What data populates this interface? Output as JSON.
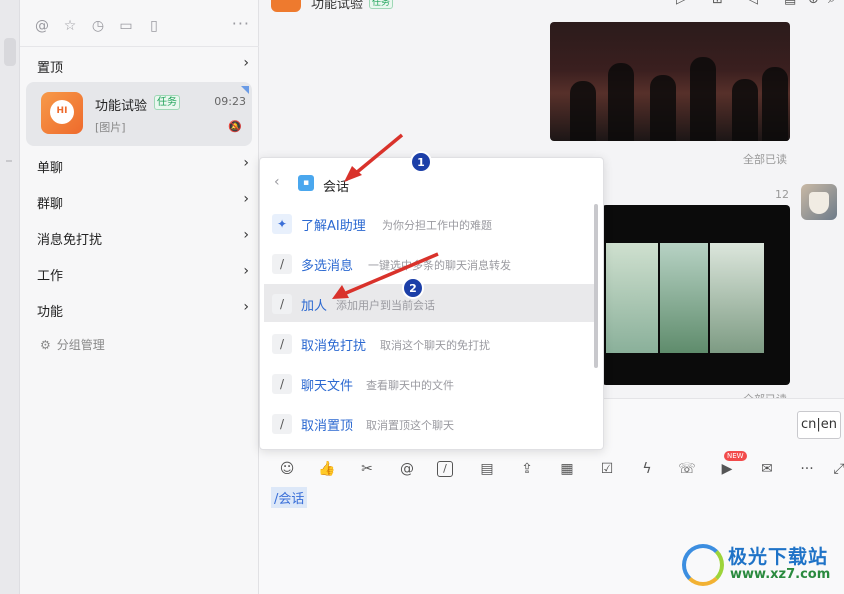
{
  "sidebar": {
    "groups": {
      "pinned": "置顶",
      "single": "单聊",
      "group": "群聊",
      "dnd": "消息免打扰",
      "work": "工作",
      "function": "功能"
    },
    "conversation": {
      "avatar_text": "HI",
      "name": "功能试验",
      "badge": "任务",
      "time": "09:23",
      "preview": "[图片]"
    },
    "group_manage": "分组管理",
    "more": "···"
  },
  "chat": {
    "header_title": "功能试验",
    "header_badge": "任务",
    "read_status": "全部已读",
    "count": "12",
    "input_lang": "cn|en",
    "new_badge": "NEW",
    "slash_text": "/会话"
  },
  "popup": {
    "session_label": "会话",
    "commands": [
      {
        "title": "了解AI助理",
        "desc": "为你分担工作中的难题"
      },
      {
        "title": "多选消息",
        "desc": "一键选中多条的聊天消息转发"
      },
      {
        "title": "加人",
        "desc": "添加用户到当前会话"
      },
      {
        "title": "取消免打扰",
        "desc": "取消这个聊天的免打扰"
      },
      {
        "title": "聊天文件",
        "desc": "查看聊天中的文件"
      },
      {
        "title": "取消置顶",
        "desc": "取消置顶这个聊天"
      }
    ]
  },
  "annotations": {
    "marker1": "1",
    "marker2": "2"
  },
  "watermark": {
    "title": "极光下载站",
    "url": "www.xz7.com"
  },
  "colors": {
    "accent": "#2c69d1",
    "arrow": "#d9322b",
    "marker": "#1c3fa8",
    "task_badge": "#20a35a"
  }
}
